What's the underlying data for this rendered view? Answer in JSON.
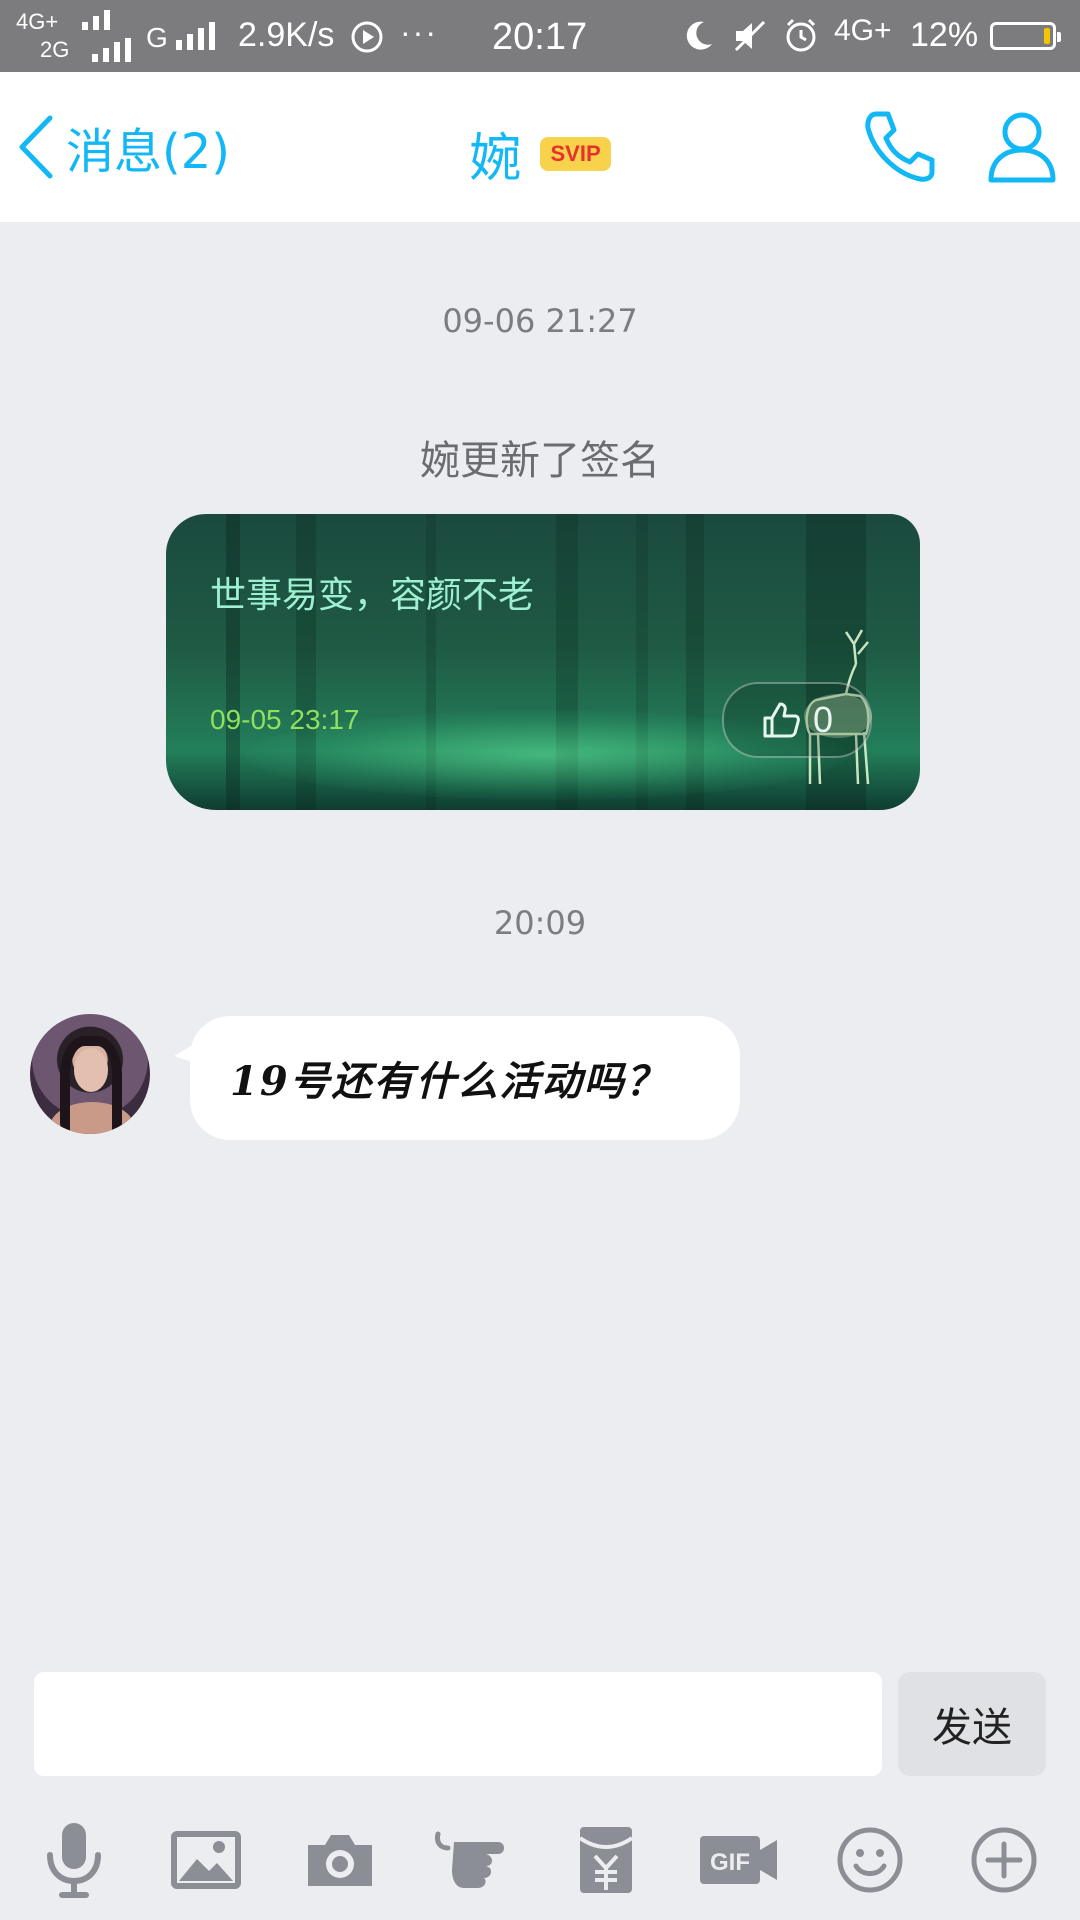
{
  "status_bar": {
    "net_top": "4G+",
    "net_bottom": "2G",
    "net_g": "G",
    "speed": "2.9K/s",
    "dots": "···",
    "time": "20:17",
    "net_4g": "4G+",
    "battery": "12%",
    "battery_level": 0.12,
    "battery_color": "#f5c400"
  },
  "header": {
    "back_label": "消息(2)",
    "title": "婉",
    "badge": "SVIP",
    "accent": "#12b7f5",
    "icons": [
      "back-chevron-icon",
      "phone-icon",
      "profile-icon"
    ]
  },
  "messages": {
    "timestamp_1": "09-06 21:27",
    "system_text": "婉更新了签名",
    "card": {
      "signature": "世事易变，容颜不老",
      "date": "09-05 23:17",
      "likes": "0"
    },
    "timestamp_2": "20:09",
    "chat_text": "19号还有什么活动吗？"
  },
  "composer": {
    "input_value": "",
    "send_label": "发送"
  },
  "toolbar": {
    "icons": [
      "microphone-icon",
      "image-icon",
      "camera-icon",
      "poke-hand-icon",
      "red-packet-icon",
      "gif-icon",
      "emoji-icon",
      "plus-icon"
    ]
  }
}
